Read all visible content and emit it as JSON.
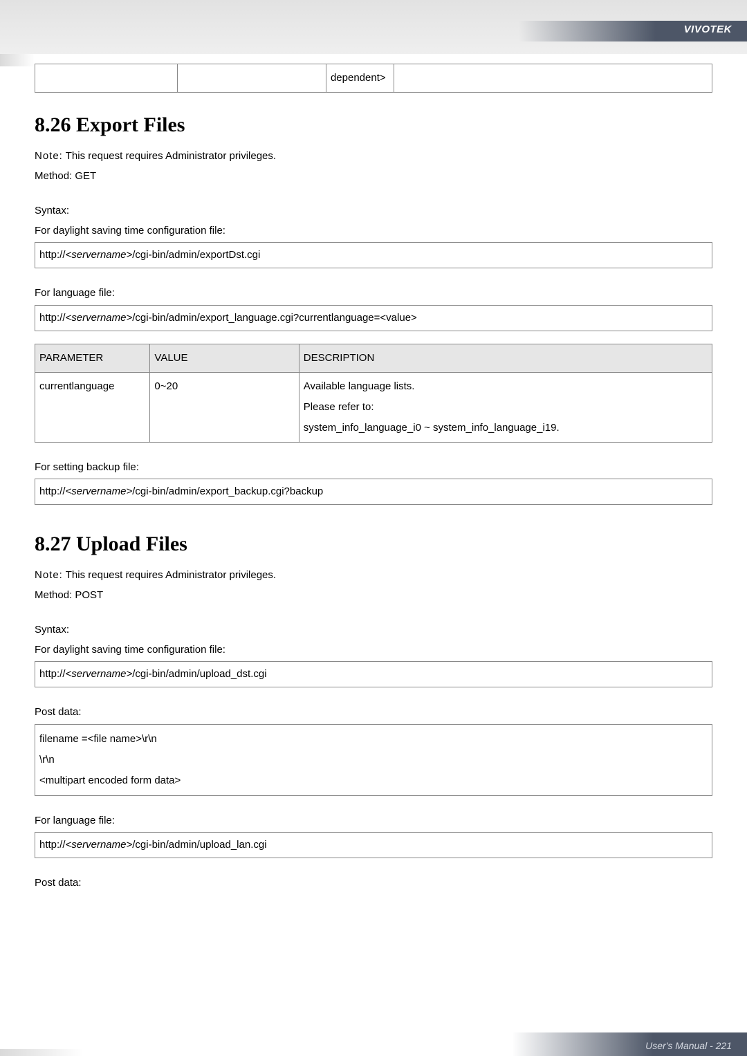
{
  "brand": "VIVOTEK",
  "top_orphan_cell": "dependent>",
  "sec826": {
    "heading": "8.26 Export Files",
    "note_label": "Note:",
    "note_text": " This request requires Administrator privileges.",
    "method": "Method: GET",
    "syntax_label": "Syntax:",
    "dst_label": "For daylight saving time configuration file:",
    "dst_url_pre": "http://",
    "dst_url_srv": "<servername>",
    "dst_url_post": "/cgi-bin/admin/exportDst.cgi",
    "lang_label": "For language file:",
    "lang_url_pre": "http://",
    "lang_url_srv": "<servername>",
    "lang_url_post": "/cgi-bin/admin/export_language.cgi?currentlanguage=<value>",
    "table": {
      "h1": "PARAMETER",
      "h2": "VALUE",
      "h3": "DESCRIPTION",
      "r1c1": "currentlanguage",
      "r1c2": "0~20",
      "r1c3_l1": "Available language lists.",
      "r1c3_l2": "Please refer to:",
      "r1c3_l3": "system_info_language_i0 ~ system_info_language_i19."
    },
    "backup_label": "For setting backup file:",
    "backup_url_pre": "http://",
    "backup_url_srv": "<servername>",
    "backup_url_post": "/cgi-bin/admin/export_backup.cgi?backup"
  },
  "sec827": {
    "heading": "8.27 Upload Files",
    "note_label": "Note:",
    "note_text": " This request requires Administrator privileges.",
    "method": "Method: POST",
    "syntax_label": "Syntax:",
    "dst_label": "For daylight saving time configuration file:",
    "dst_url_pre": "http://",
    "dst_url_srv": "<servername>",
    "dst_url_post": "/cgi-bin/admin/upload_dst.cgi",
    "post_label": "Post data:",
    "post_box_l1": "filename =<file name>\\r\\n",
    "post_box_l2": "\\r\\n",
    "post_box_l3": "<multipart encoded form data>",
    "lang_label": "For language file:",
    "lang_url_pre": "http://",
    "lang_url_srv": "<servername>",
    "lang_url_post": "/cgi-bin/admin/upload_lan.cgi",
    "post_label2": "Post data:"
  },
  "footer": "User's Manual - 221"
}
